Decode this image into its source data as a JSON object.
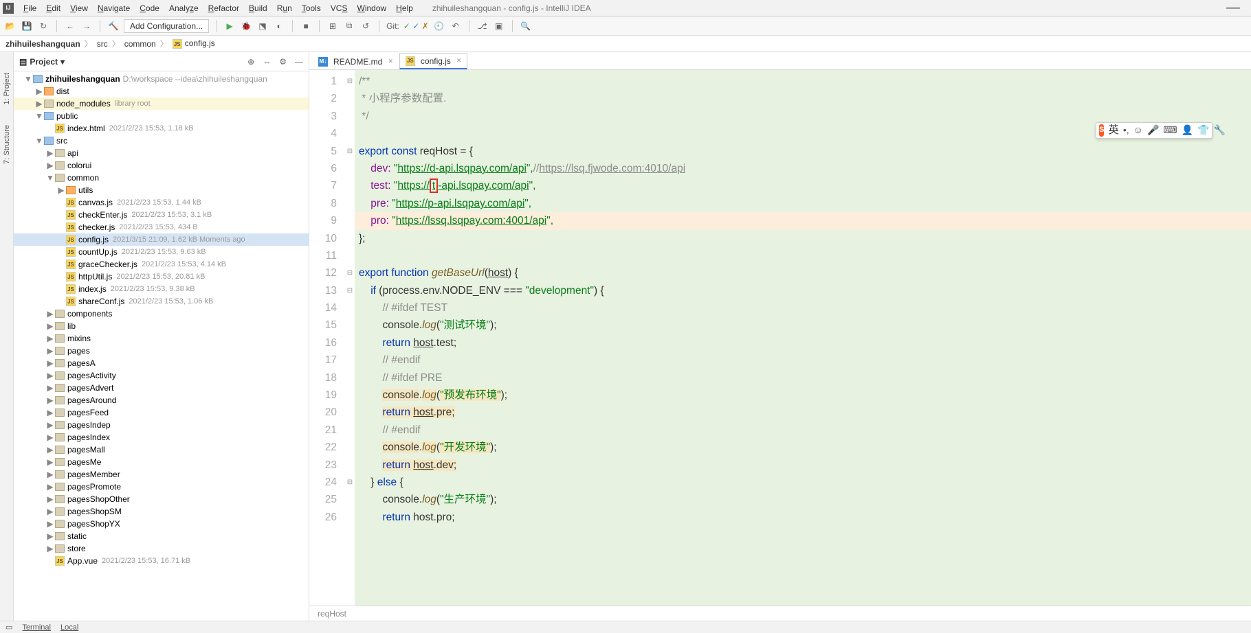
{
  "title": "zhihuileshangquan - config.js - IntelliJ IDEA",
  "menu": [
    "File",
    "Edit",
    "View",
    "Navigate",
    "Code",
    "Analyze",
    "Refactor",
    "Build",
    "Run",
    "Tools",
    "VCS",
    "Window",
    "Help"
  ],
  "addConfig": "Add Configuration...",
  "gitLabel": "Git:",
  "breadcrumbs": [
    "zhihuileshangquan",
    "src",
    "common",
    "config.js"
  ],
  "leftStripe": [
    "1: Project",
    "7: Structure"
  ],
  "projectPanel": {
    "title": "Project"
  },
  "tree": [
    {
      "lvl": 0,
      "ch": "v",
      "icon": "blue",
      "name": "zhihuileshangquan",
      "meta": "D:\\workspace --idea\\zhihuileshangquan",
      "root": true
    },
    {
      "lvl": 1,
      "ch": ">",
      "icon": "orange",
      "name": "dist"
    },
    {
      "lvl": 1,
      "ch": ">",
      "icon": "folder",
      "name": "node_modules",
      "meta": "library root",
      "hl": true
    },
    {
      "lvl": 1,
      "ch": "v",
      "icon": "blue",
      "name": "public"
    },
    {
      "lvl": 2,
      "ch": "",
      "icon": "js",
      "name": "index.html",
      "meta": "2021/2/23 15:53, 1.18 kB"
    },
    {
      "lvl": 1,
      "ch": "v",
      "icon": "blue",
      "name": "src"
    },
    {
      "lvl": 2,
      "ch": ">",
      "icon": "folder",
      "name": "api"
    },
    {
      "lvl": 2,
      "ch": ">",
      "icon": "folder",
      "name": "colorui"
    },
    {
      "lvl": 2,
      "ch": "v",
      "icon": "folder",
      "name": "common"
    },
    {
      "lvl": 3,
      "ch": ">",
      "icon": "orange",
      "name": "utils"
    },
    {
      "lvl": 3,
      "ch": "",
      "icon": "js",
      "name": "canvas.js",
      "meta": "2021/2/23 15:53, 1.44 kB"
    },
    {
      "lvl": 3,
      "ch": "",
      "icon": "js",
      "name": "checkEnter.js",
      "meta": "2021/2/23 15:53, 3.1 kB"
    },
    {
      "lvl": 3,
      "ch": "",
      "icon": "js",
      "name": "checker.js",
      "meta": "2021/2/23 15:53, 434 B"
    },
    {
      "lvl": 3,
      "ch": "",
      "icon": "js",
      "name": "config.js",
      "meta": "2021/3/15 21:09, 1.62 kB Moments ago",
      "sel": true
    },
    {
      "lvl": 3,
      "ch": "",
      "icon": "js",
      "name": "countUp.js",
      "meta": "2021/2/23 15:53, 9.63 kB"
    },
    {
      "lvl": 3,
      "ch": "",
      "icon": "js",
      "name": "graceChecker.js",
      "meta": "2021/2/23 15:53, 4.14 kB"
    },
    {
      "lvl": 3,
      "ch": "",
      "icon": "js",
      "name": "httpUtil.js",
      "meta": "2021/2/23 15:53, 20.81 kB"
    },
    {
      "lvl": 3,
      "ch": "",
      "icon": "js",
      "name": "index.js",
      "meta": "2021/2/23 15:53, 9.38 kB"
    },
    {
      "lvl": 3,
      "ch": "",
      "icon": "js",
      "name": "shareConf.js",
      "meta": "2021/2/23 15:53, 1.06 kB"
    },
    {
      "lvl": 2,
      "ch": ">",
      "icon": "folder",
      "name": "components"
    },
    {
      "lvl": 2,
      "ch": ">",
      "icon": "folder",
      "name": "lib"
    },
    {
      "lvl": 2,
      "ch": ">",
      "icon": "folder",
      "name": "mixins"
    },
    {
      "lvl": 2,
      "ch": ">",
      "icon": "folder",
      "name": "pages"
    },
    {
      "lvl": 2,
      "ch": ">",
      "icon": "folder",
      "name": "pagesA"
    },
    {
      "lvl": 2,
      "ch": ">",
      "icon": "folder",
      "name": "pagesActivity"
    },
    {
      "lvl": 2,
      "ch": ">",
      "icon": "folder",
      "name": "pagesAdvert"
    },
    {
      "lvl": 2,
      "ch": ">",
      "icon": "folder",
      "name": "pagesAround"
    },
    {
      "lvl": 2,
      "ch": ">",
      "icon": "folder",
      "name": "pagesFeed"
    },
    {
      "lvl": 2,
      "ch": ">",
      "icon": "folder",
      "name": "pagesIndep"
    },
    {
      "lvl": 2,
      "ch": ">",
      "icon": "folder",
      "name": "pagesIndex"
    },
    {
      "lvl": 2,
      "ch": ">",
      "icon": "folder",
      "name": "pagesMall"
    },
    {
      "lvl": 2,
      "ch": ">",
      "icon": "folder",
      "name": "pagesMe"
    },
    {
      "lvl": 2,
      "ch": ">",
      "icon": "folder",
      "name": "pagesMember"
    },
    {
      "lvl": 2,
      "ch": ">",
      "icon": "folder",
      "name": "pagesPromote"
    },
    {
      "lvl": 2,
      "ch": ">",
      "icon": "folder",
      "name": "pagesShopOther"
    },
    {
      "lvl": 2,
      "ch": ">",
      "icon": "folder",
      "name": "pagesShopSM"
    },
    {
      "lvl": 2,
      "ch": ">",
      "icon": "folder",
      "name": "pagesShopYX"
    },
    {
      "lvl": 2,
      "ch": ">",
      "icon": "folder",
      "name": "static"
    },
    {
      "lvl": 2,
      "ch": ">",
      "icon": "folder",
      "name": "store"
    },
    {
      "lvl": 2,
      "ch": "",
      "icon": "js",
      "name": "App.vue",
      "meta": "2021/2/23 15:53, 16.71 kB"
    }
  ],
  "tabs": [
    {
      "icon": "md",
      "label": "README.md",
      "active": false
    },
    {
      "icon": "js",
      "label": "config.js",
      "active": true
    }
  ],
  "code": {
    "cmt1": "/**",
    "cmt2": " * 小程序参数配置.",
    "cmt3": " */",
    "l5_export": "export ",
    "l5_const": "const ",
    "l5_name": "reqHost ",
    "l5_rest": "= {",
    "l6_key": "    dev: ",
    "l6_q": "\"",
    "l6_url": "https://d-api.lsqpay.com/api",
    "l6_end": "\",",
    "l6_c": "//",
    "l6_curl": "https://lsq.fjwode.com:4010/api",
    "l7_key": "    test: ",
    "l7_q": "\"",
    "l7_u1": "https://",
    "l7_t": "t",
    "l7_u2": "-api.lsqpay.com/api",
    "l7_end": "\",",
    "l8_key": "    pre: ",
    "l8_q": "\"",
    "l8_url": "https://p-api.lsqpay.com/api",
    "l8_end": "\",",
    "l9_key": "    pro: ",
    "l9_q": "\"",
    "l9_url": "https://lssq.lsqpay.com:4001/api",
    "l9_end": "\",",
    "l10": "};",
    "l12_export": "export ",
    "l12_function": "function ",
    "l12_fn": "getBaseUrl",
    "l12_open": "(",
    "l12_p": "host",
    "l12_close": ") {",
    "l13_if": "    if ",
    "l13_cond": "(process.env.NODE_ENV === ",
    "l13_str": "\"development\"",
    "l13_close": ") {",
    "l14": "        // #ifdef TEST",
    "l15_a": "        console.",
    "l15_log": "log",
    "l15_b": "(",
    "l15_str": "\"测试环境\"",
    "l15_c": ");",
    "l16_a": "        ",
    "l16_ret": "return ",
    "l16_h": "host",
    "l16_rest": ".test;",
    "l17": "        // #endif",
    "l18": "        // #ifdef PRE",
    "l19_a": "        ",
    "l19_con": "console",
    "l19_dot": ".",
    "l19_log": "log",
    "l19_b": "(",
    "l19_str": "\"预发布环境\"",
    "l19_c": ");",
    "l20_a": "        ",
    "l20_ret": "return ",
    "l20_h": "host",
    "l20_rest": ".pre;",
    "l21": "        // #endif",
    "l22_a": "        ",
    "l22_con": "console",
    "l22_dot": ".",
    "l22_log": "log",
    "l22_b": "(",
    "l22_str": "\"开发环境\"",
    "l22_c": ");",
    "l23_a": "        ",
    "l23_ret": "return ",
    "l23_h": "host",
    "l23_rest": ".dev;",
    "l24_a": "    } ",
    "l24_else": "else ",
    "l24_b": "{",
    "l25_a": "        console.",
    "l25_log": "log",
    "l25_b": "(",
    "l25_str": "\"生产环境\"",
    "l25_c": ");",
    "l26_a": "        ",
    "l26_ret": "return ",
    "l26_rest": "host.pro;"
  },
  "breadcrumbBottom": "reqHost",
  "imeLang": "英",
  "bottomStripe": [
    "Terminal",
    "Local"
  ]
}
